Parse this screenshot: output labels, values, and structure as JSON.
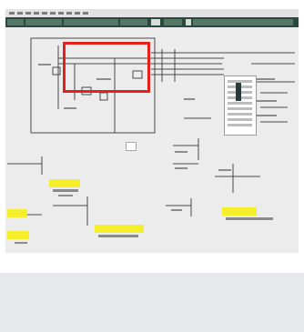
{
  "screenshot": {
    "description_only_no_readable_text": true
  },
  "colors": {
    "background": "#e6e8eb",
    "screen": "#ececec",
    "titlebar": "#27493f",
    "highlight": "#f5ef2b",
    "callout_border": "#e3201b"
  },
  "icons": [
    "menu-item-icon",
    "list-selection-icon",
    "note-icon"
  ]
}
